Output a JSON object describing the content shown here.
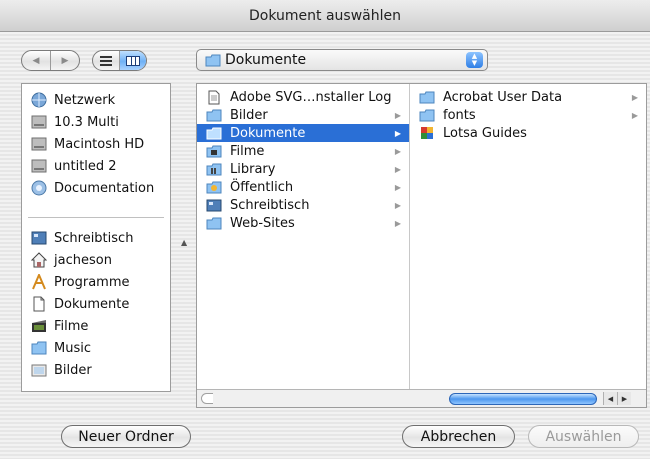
{
  "window": {
    "title": "Dokument auswählen"
  },
  "toolbar": {
    "back_icon": "◀",
    "forward_icon": "▶",
    "path_popup": {
      "label": "Dokumente",
      "icon": "folder-icon"
    }
  },
  "sidebar": {
    "devices": [
      {
        "label": "Netzwerk",
        "icon": "network-icon"
      },
      {
        "label": "10.3 Multi",
        "icon": "hard-disk-icon"
      },
      {
        "label": "Macintosh HD",
        "icon": "hard-disk-icon"
      },
      {
        "label": "untitled 2",
        "icon": "hard-disk-icon"
      },
      {
        "label": "Documentation",
        "icon": "network-volume-icon"
      }
    ],
    "places": [
      {
        "label": "Schreibtisch",
        "icon": "desktop-icon"
      },
      {
        "label": "jacheson",
        "icon": "home-icon"
      },
      {
        "label": "Programme",
        "icon": "applications-icon"
      },
      {
        "label": "Dokumente",
        "icon": "documents-icon"
      },
      {
        "label": "Filme",
        "icon": "movies-icon"
      },
      {
        "label": "Music",
        "icon": "music-folder-icon"
      },
      {
        "label": "Bilder",
        "icon": "pictures-icon"
      }
    ]
  },
  "browser": {
    "column1": [
      {
        "label": "Adobe SVG…nstaller Log",
        "icon": "document-icon",
        "arrow": ""
      },
      {
        "label": "Bilder",
        "icon": "folder-icon",
        "arrow": "▶"
      },
      {
        "label": "Dokumente",
        "icon": "folder-icon",
        "arrow": "▶",
        "selected": true
      },
      {
        "label": "Filme",
        "icon": "folder-icon",
        "arrow": "▶"
      },
      {
        "label": "Library",
        "icon": "folder-icon",
        "arrow": "▶"
      },
      {
        "label": "Öffentlich",
        "icon": "folder-icon",
        "arrow": "▶"
      },
      {
        "label": "Schreibtisch",
        "icon": "desktop-icon",
        "arrow": "▶"
      },
      {
        "label": "Web-Sites",
        "icon": "folder-icon",
        "arrow": "▶"
      }
    ],
    "column2": [
      {
        "label": "Acrobat User Data",
        "icon": "folder-icon",
        "arrow": "▶"
      },
      {
        "label": "fonts",
        "icon": "folder-icon",
        "arrow": "▶"
      },
      {
        "label": "Lotsa Guides",
        "icon": "app-document-icon",
        "arrow": ""
      }
    ],
    "scroll_left_icon": "◀",
    "scroll_right_icon": "▶"
  },
  "buttons": {
    "new_folder": "Neuer Ordner",
    "cancel": "Abbrechen",
    "choose": "Auswählen"
  },
  "colors": {
    "selection": "#2a6fd6",
    "accent": "#4d97ee"
  }
}
